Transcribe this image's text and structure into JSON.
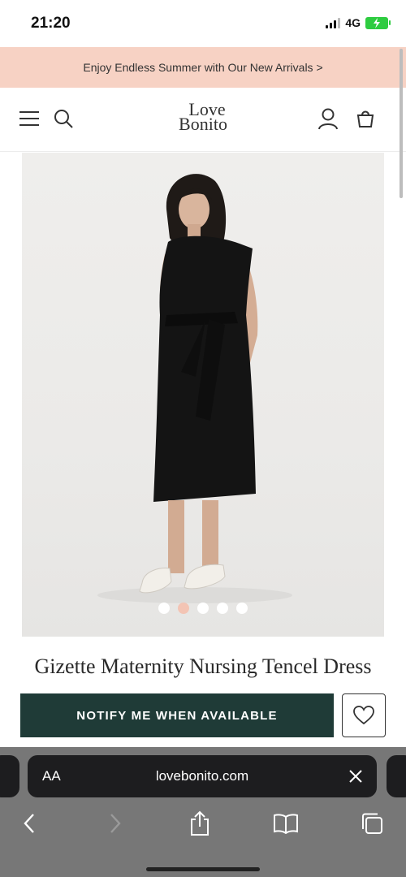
{
  "status": {
    "time": "21:20",
    "network": "4G"
  },
  "promo": {
    "text": "Enjoy Endless Summer with Our New Arrivals >"
  },
  "header": {
    "logo_line1": "Love",
    "logo_line2": "Bonito",
    "menu_icon": "hamburger-icon",
    "search_icon": "search-icon",
    "account_icon": "user-icon",
    "bag_icon": "shopping-bag-icon"
  },
  "product": {
    "title": "Gizette Maternity Nursing Tencel Dress",
    "image_alt": "Model wearing black sleeveless dress with tie waist",
    "carousel": {
      "count": 5,
      "active": 2
    },
    "notify_label": "NOTIFY ME WHEN AVAILABLE",
    "wishlist_icon": "heart-icon"
  },
  "browser": {
    "text_size_label": "AA",
    "url": "lovebonito.com"
  },
  "colors": {
    "promo_bg": "#f7d2c4",
    "button_bg": "#1f3b37",
    "active_dot": "#f3c4b4"
  }
}
